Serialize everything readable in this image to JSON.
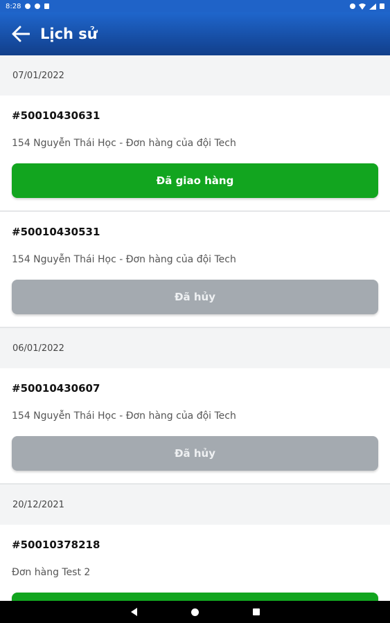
{
  "status_bar": {
    "time": "8:28"
  },
  "header": {
    "title": "Lịch sử"
  },
  "groups": [
    {
      "date": "07/01/2022",
      "orders": [
        {
          "code": "#50010430631",
          "desc": "154 Nguyễn Thái Học - Đơn hàng của đội Tech",
          "status": "Đã giao hàng"
        },
        {
          "code": "#50010430531",
          "desc": "154 Nguyễn Thái Học - Đơn hàng của đội Tech",
          "status": "Đã hủy"
        }
      ]
    },
    {
      "date": "06/01/2022",
      "orders": [
        {
          "code": "#50010430607",
          "desc": "154 Nguyễn Thái Học - Đơn hàng của đội Tech",
          "status": "Đã hủy"
        }
      ]
    },
    {
      "date": "20/12/2021",
      "orders": [
        {
          "code": "#50010378218",
          "desc": "Đơn hàng Test 2",
          "status": ""
        }
      ]
    }
  ],
  "colors": {
    "delivered": "#12a51f",
    "cancelled": "#a4aab0",
    "header": "#1a56b4"
  }
}
